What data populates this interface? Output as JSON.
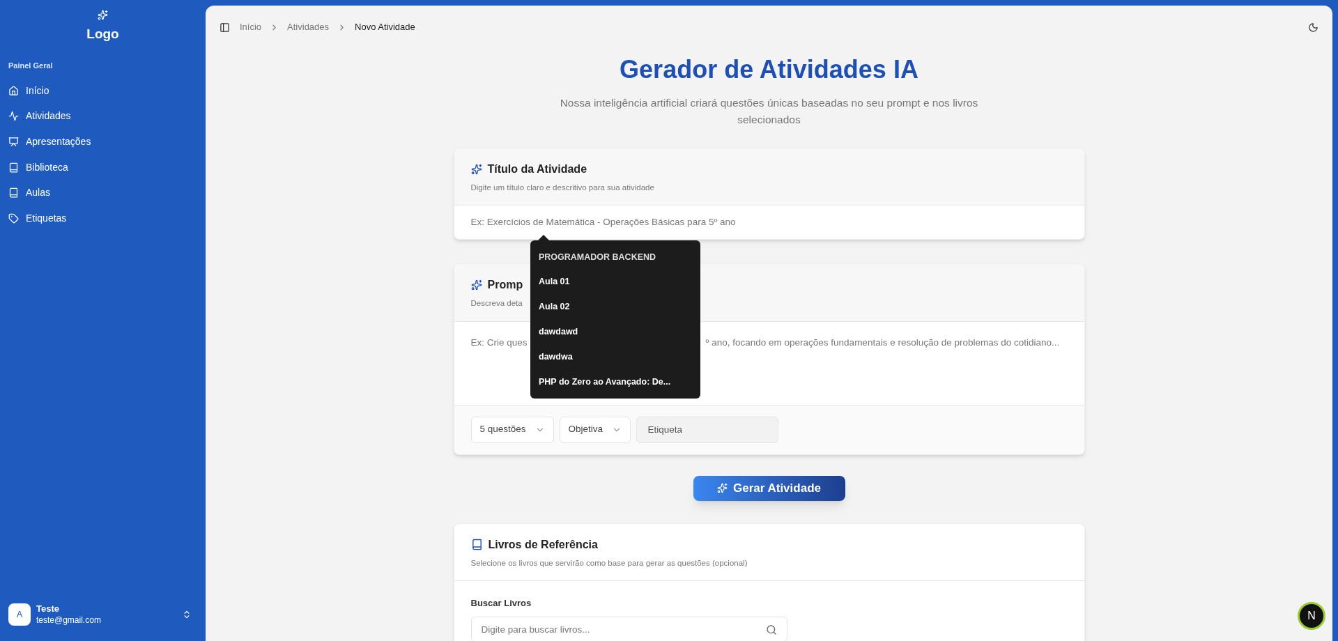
{
  "sidebar": {
    "logo": "Logo",
    "section": "Painel Geral",
    "items": [
      {
        "label": "Início"
      },
      {
        "label": "Atividades"
      },
      {
        "label": "Apresentações"
      },
      {
        "label": "Biblioteca"
      },
      {
        "label": "Aulas"
      },
      {
        "label": "Etiquetas"
      }
    ],
    "user": {
      "avatar": "A",
      "name": "Teste",
      "email": "teste@gmail.com"
    }
  },
  "breadcrumbs": [
    "Início",
    "Atividades",
    "Novo Atividade"
  ],
  "page": {
    "title": "Gerador de Atividades IA",
    "subtitle": "Nossa inteligência artificial criará questões únicas baseadas no seu prompt e nos livros selecionados"
  },
  "title_card": {
    "heading": "Título da Atividade",
    "description": "Digite um título claro e descritivo para sua atividade",
    "placeholder": "Ex: Exercícios de Matemática - Operações Básicas para 5º ano"
  },
  "prompt_card": {
    "heading": "Promp",
    "description": "Descreva deta",
    "placeholder_start": "Ex: Crie ques",
    "placeholder_end": "º ano, focando em operações fundamentais e resolução de problemas do cotidiano...",
    "question_count": "5 questões",
    "question_type": "Objetiva",
    "tag_placeholder": "Etiqueta"
  },
  "popup": {
    "items": [
      {
        "label": "PROGRAMADOR BACKEND",
        "kind": "header"
      },
      {
        "label": "Aula 01",
        "kind": "item"
      },
      {
        "label": "Aula 02",
        "kind": "item"
      },
      {
        "label": "dawdawd",
        "kind": "item"
      },
      {
        "label": "dawdwa",
        "kind": "item"
      },
      {
        "label": "PHP do Zero ao Avançado: De...",
        "kind": "item"
      }
    ]
  },
  "generate_button": "Gerar Atividade",
  "books_card": {
    "heading": "Livros de Referência",
    "description": "Selecione os livros que servirão como base para gerar as questões (opcional)",
    "search_label": "Buscar Livros",
    "search_placeholder": "Digite para buscar livros..."
  },
  "dev_badge": "N"
}
